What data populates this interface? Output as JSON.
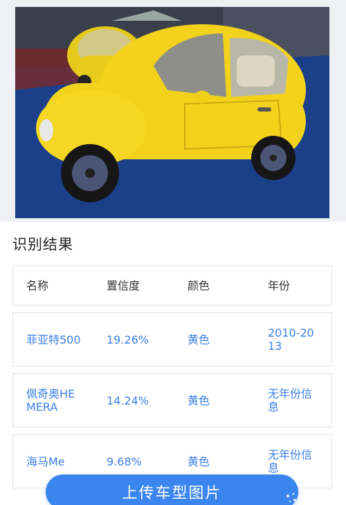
{
  "photo": {
    "alt": "yellow-car-photo",
    "colors": {
      "car_body": "#f2d21b",
      "floor": "#1c3f8a",
      "background": "#2a2e38"
    }
  },
  "result": {
    "title": "识别结果",
    "headers": {
      "name": "名称",
      "confidence": "置信度",
      "color": "颜色",
      "year": "年份"
    },
    "rows": [
      {
        "name": "菲亚特500",
        "confidence": "19.26%",
        "color": "黄色",
        "year": "2010-2013"
      },
      {
        "name": "佩奇奥HEMERA",
        "confidence": "14.24%",
        "color": "黄色",
        "year": "无年份信息"
      },
      {
        "name": "海马Me",
        "confidence": "9.68%",
        "color": "黄色",
        "year": "无年份信息"
      }
    ]
  },
  "actions": {
    "upload_label": "上传车型图片"
  },
  "theme": {
    "accent": "#3a85ee",
    "result_text": "#3b7fe6"
  }
}
